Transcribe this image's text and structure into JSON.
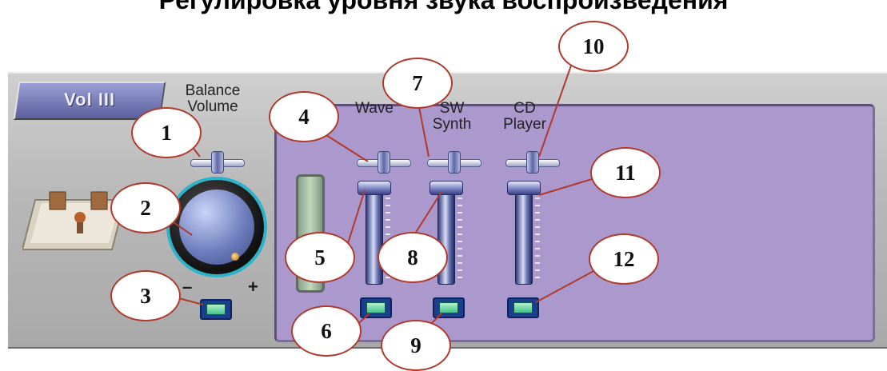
{
  "page_title": "Регулировка уровня звука воспроизведения",
  "app": {
    "tab_label": "Vol III"
  },
  "master": {
    "balance_label": "Balance",
    "volume_label": "Volume",
    "minus_label": "–",
    "plus_label": "+"
  },
  "channels": [
    {
      "label_line1": "Wave",
      "label_line2": ""
    },
    {
      "label_line1": "SW",
      "label_line2": "Synth"
    },
    {
      "label_line1": "CD",
      "label_line2": "Player"
    }
  ],
  "callouts": [
    "1",
    "2",
    "3",
    "4",
    "5",
    "6",
    "7",
    "8",
    "9",
    "10",
    "11",
    "12"
  ],
  "colors": {
    "mixer_panel": "#ab98cc",
    "callout_border": "#b03a2e",
    "knob_ring": "#2bb3c9",
    "mute_led": "#43c48a"
  },
  "icons": {
    "stage": "stage-image-icon",
    "knob": "volume-knob",
    "mute": "mute-button"
  }
}
